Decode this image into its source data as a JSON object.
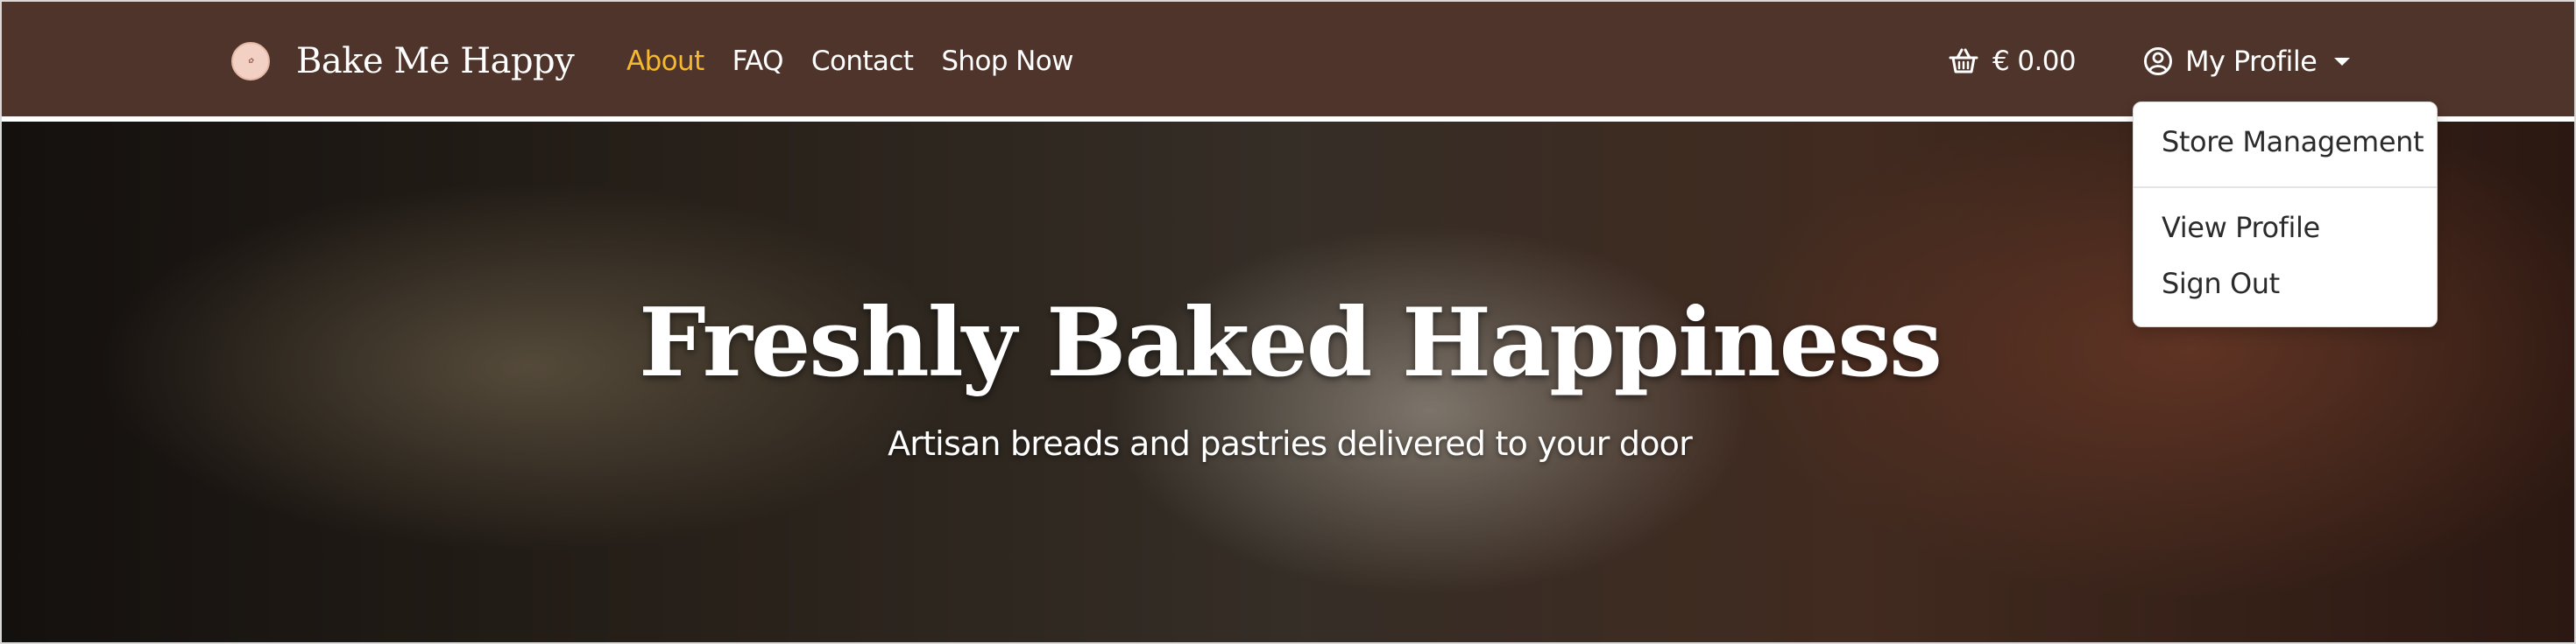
{
  "brand": {
    "name": "Bake Me Happy",
    "logo_text": "Bake Me Happy"
  },
  "nav": {
    "links": [
      {
        "label": "About",
        "active": true
      },
      {
        "label": "FAQ",
        "active": false
      },
      {
        "label": "Contact",
        "active": false
      },
      {
        "label": "Shop Now",
        "active": false
      }
    ],
    "active_color": "#f5b82e"
  },
  "cart": {
    "icon": "basket-icon",
    "total": "€ 0.00"
  },
  "profile": {
    "icon": "user-circle-icon",
    "label": "My Profile",
    "expanded": true,
    "menu": {
      "items": [
        "Store Management",
        "View Profile",
        "Sign Out"
      ]
    }
  },
  "hero": {
    "title": "Freshly Baked Happiness",
    "subtitle": "Artisan breads and pastries delivered to your door"
  },
  "colors": {
    "navbar_bg": "#4e342b",
    "text_light": "#ffffff"
  }
}
